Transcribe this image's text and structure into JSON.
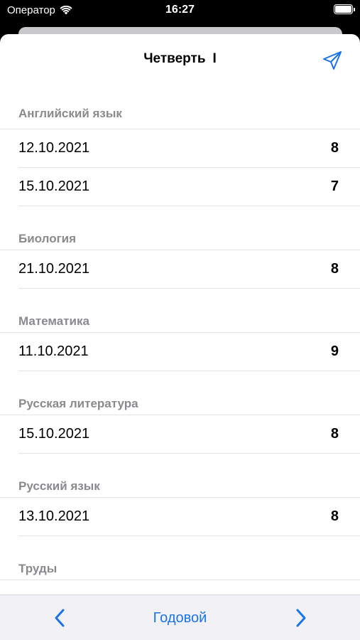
{
  "status_bar": {
    "carrier": "Оператор",
    "time": "16:27"
  },
  "header": {
    "title": "Четверть",
    "quarter": "I",
    "send_icon": "paper-plane-icon"
  },
  "sections": [
    {
      "subject": "Английский язык",
      "rows": [
        {
          "date": "12.10.2021",
          "grade": "8"
        },
        {
          "date": "15.10.2021",
          "grade": "7"
        }
      ]
    },
    {
      "subject": "Биология",
      "rows": [
        {
          "date": "21.10.2021",
          "grade": "8"
        }
      ]
    },
    {
      "subject": "Математика",
      "rows": [
        {
          "date": "11.10.2021",
          "grade": "9"
        }
      ]
    },
    {
      "subject": "Русская литература",
      "rows": [
        {
          "date": "15.10.2021",
          "grade": "8"
        }
      ]
    },
    {
      "subject": "Русский язык",
      "rows": [
        {
          "date": "13.10.2021",
          "grade": "8"
        }
      ]
    },
    {
      "subject": "Труды",
      "rows": []
    }
  ],
  "toolbar": {
    "prev_icon": "chevron-left-icon",
    "center_label": "Годовой",
    "next_icon": "chevron-right-icon"
  },
  "colors": {
    "accent": "#1a73e8",
    "section_header": "#8a8a8e"
  }
}
